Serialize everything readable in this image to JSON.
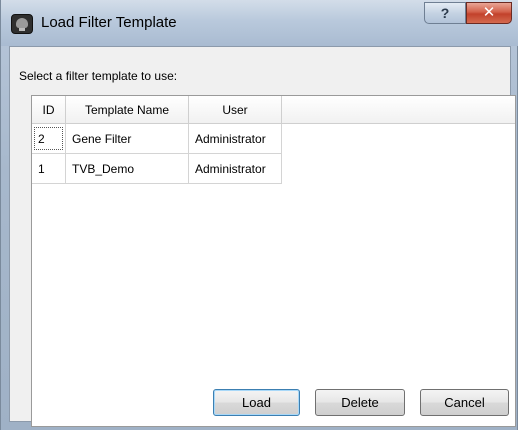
{
  "window": {
    "title": "Load Filter Template",
    "help_button": "?",
    "close_button": "✕"
  },
  "prompt": "Select a filter template to use:",
  "table": {
    "columns": [
      "ID",
      "Template Name",
      "User"
    ],
    "rows": [
      {
        "id": "2",
        "name": "Gene Filter",
        "user": "Administrator"
      },
      {
        "id": "1",
        "name": "TVB_Demo",
        "user": "Administrator"
      }
    ]
  },
  "buttons": {
    "load": "Load",
    "delete": "Delete",
    "cancel": "Cancel"
  },
  "colors": {
    "title_bar": "#b9c9dc",
    "close_red": "#c2412b",
    "default_button_border": "#3c7fb1"
  },
  "icons": {
    "app": "tvb-app-icon",
    "help": "help-icon",
    "close": "close-icon"
  }
}
